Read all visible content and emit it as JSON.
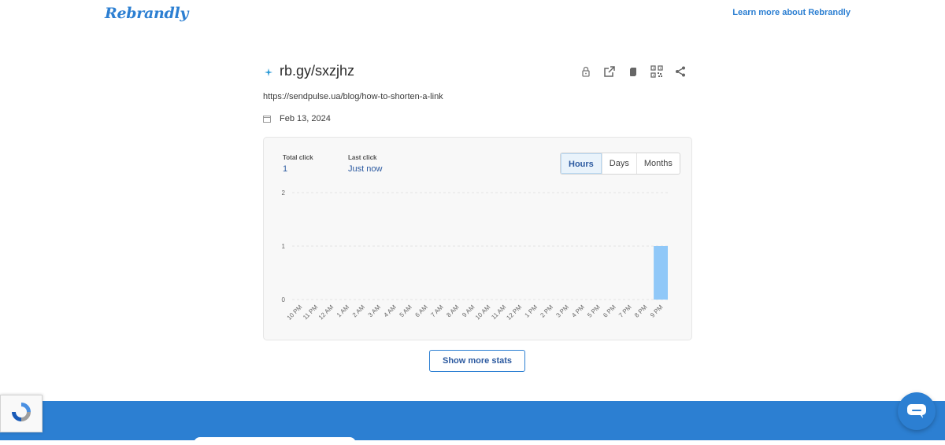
{
  "header": {
    "logo_text": "Rebrandly",
    "learn_more": "Learn more about Rebrandly"
  },
  "link": {
    "short_url": "rb.gy/sxzjhz",
    "destination": "https://sendpulse.ua/blog/how-to-shorten-a-link",
    "date": "Feb 13, 2024",
    "actions": [
      "lock-icon",
      "open-external-icon",
      "copy-icon",
      "qr-code-icon",
      "share-icon"
    ]
  },
  "stats": {
    "total_click_label": "Total click",
    "total_click_value": "1",
    "last_click_label": "Last click",
    "last_click_value": "Just now",
    "ranges": [
      "Hours",
      "Days",
      "Months"
    ],
    "active_range": "Hours"
  },
  "chart_data": {
    "type": "bar",
    "categories": [
      "10 PM",
      "11 PM",
      "12 AM",
      "1 AM",
      "2 AM",
      "3 AM",
      "4 AM",
      "5 AM",
      "6 AM",
      "7 AM",
      "8 AM",
      "9 AM",
      "10 AM",
      "11 AM",
      "12 PM",
      "1 PM",
      "2 PM",
      "3 PM",
      "4 PM",
      "5 PM",
      "6 PM",
      "7 PM",
      "8 PM",
      "9 PM"
    ],
    "values": [
      0,
      0,
      0,
      0,
      0,
      0,
      0,
      0,
      0,
      0,
      0,
      0,
      0,
      0,
      0,
      0,
      0,
      0,
      0,
      0,
      0,
      0,
      0,
      1
    ],
    "yticks": [
      "0",
      "1",
      "2"
    ],
    "ylim": [
      0,
      2
    ],
    "bar_color": "#90c8f8",
    "grid": true
  },
  "show_more_label": "Show more stats",
  "colors": {
    "brand": "#2c7fd2",
    "accent_text": "#2c5aa0"
  }
}
